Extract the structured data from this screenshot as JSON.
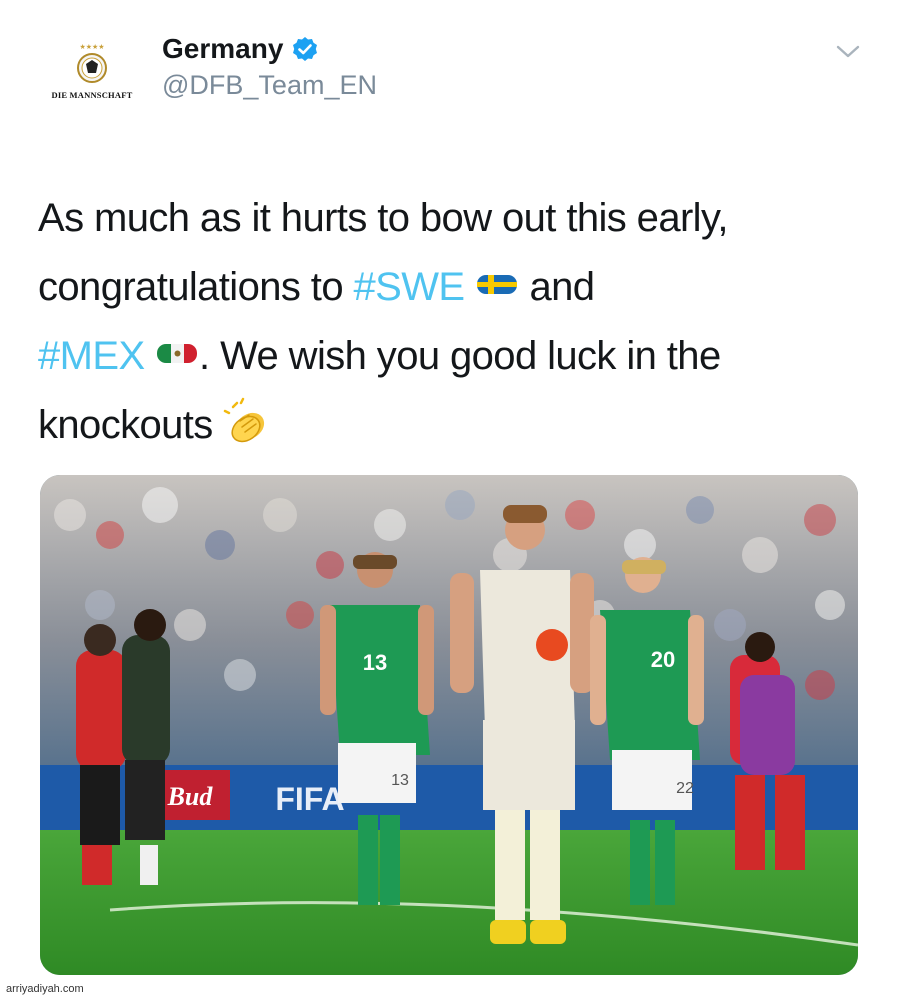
{
  "tweet": {
    "avatar": {
      "text": "DIE MANNSCHAFT",
      "stars": "★★★★"
    },
    "author": {
      "name": "Germany",
      "handle": "@DFB_Team_EN"
    },
    "menu_icon": "chevron-down-icon",
    "text": {
      "line1": "As much as it hurts to bow out this early,",
      "line2_before": "congratulations to ",
      "hashtag_swe": "#SWE",
      "line2_after": " and",
      "hashtag_mex": "#MEX",
      "line3_after": ". We wish you good luck in the",
      "line4": "knockouts"
    },
    "image": {
      "jerseys": [
        "13",
        "20",
        "13",
        "22"
      ],
      "ad_text": "FIFA",
      "sponsor_text": "Bud"
    }
  },
  "watermark": "arriyadiyah.com",
  "colors": {
    "hashtag": "#4fc3f0",
    "verified": "#1da1f2",
    "handle": "#7a8a99",
    "germany_green": "#1e9a54",
    "pitch": "#3f9a2e"
  }
}
